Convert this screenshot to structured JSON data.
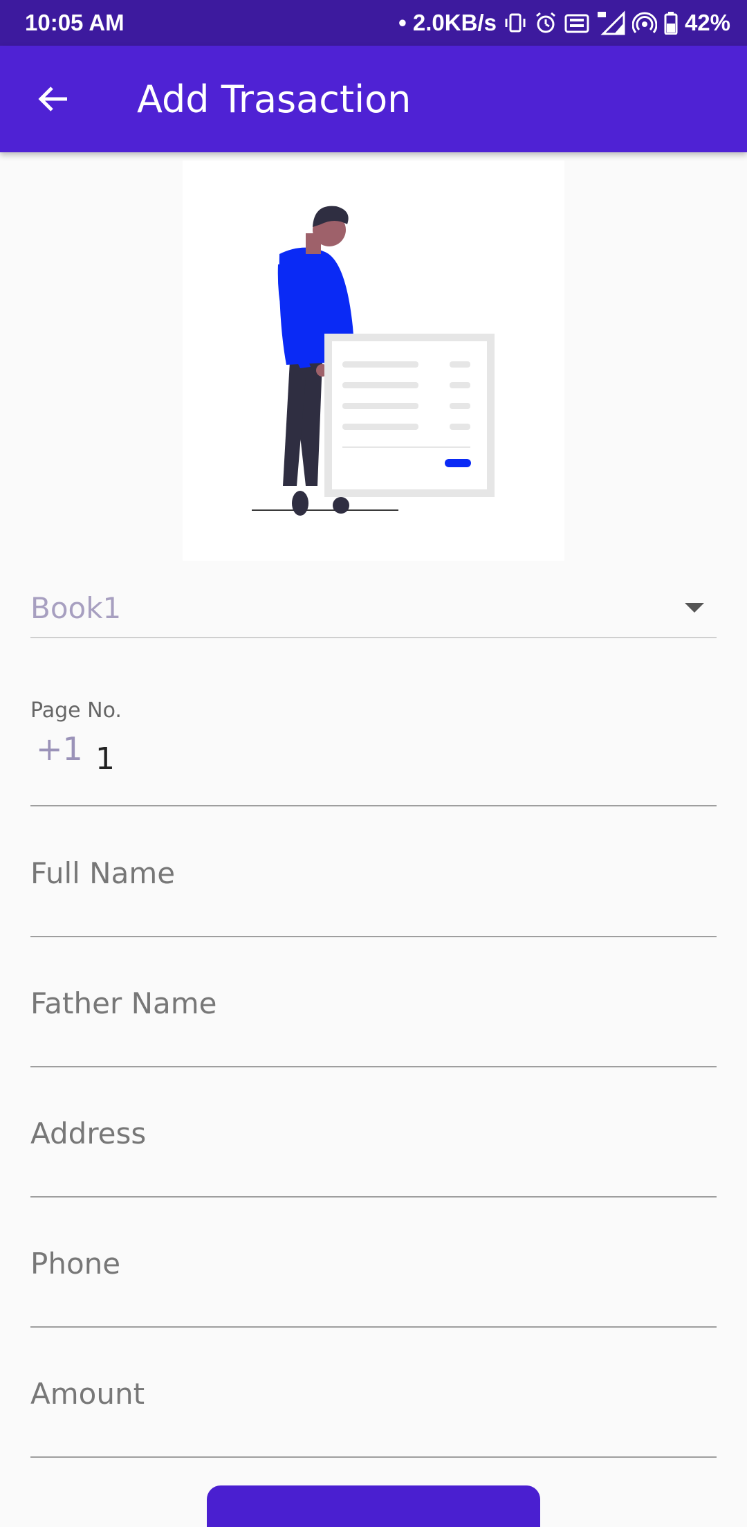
{
  "status_bar": {
    "time": "10:05 AM",
    "network_speed": "• 2.0KB/s",
    "battery": "42%",
    "icons": [
      "vibrate-icon",
      "alarm-icon",
      "volte-icon",
      "signal-4g-icon",
      "hotspot-icon",
      "battery-icon"
    ]
  },
  "app_bar": {
    "title": "Add Trasaction",
    "back_icon": "arrow-left-icon"
  },
  "colors": {
    "app_bar": "#4f22d4",
    "status_bar": "#3d1a9e",
    "accent_blue": "#0a2af5"
  },
  "form": {
    "book_select": {
      "value": "Book1"
    },
    "page_no": {
      "label": "Page No.",
      "prefix": "+1",
      "value": "1"
    },
    "full_name": {
      "placeholder": "Full Name"
    },
    "father_name": {
      "placeholder": "Father Name"
    },
    "address": {
      "placeholder": "Address"
    },
    "phone": {
      "placeholder": "Phone"
    },
    "amount": {
      "placeholder": "Amount"
    }
  }
}
